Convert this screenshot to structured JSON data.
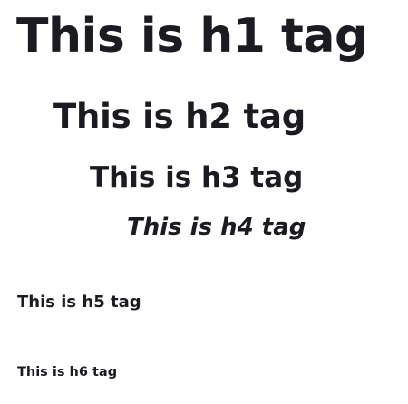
{
  "headings": {
    "h1": "This is h1 tag",
    "h2": "This is h2 tag",
    "h3": "This is h3 tag",
    "h4": "This is h4 tag",
    "h5": "This is h5 tag",
    "h6": "This is h6 tag"
  },
  "colors": {
    "text": "#1b1b22",
    "background": "#ffffff"
  }
}
